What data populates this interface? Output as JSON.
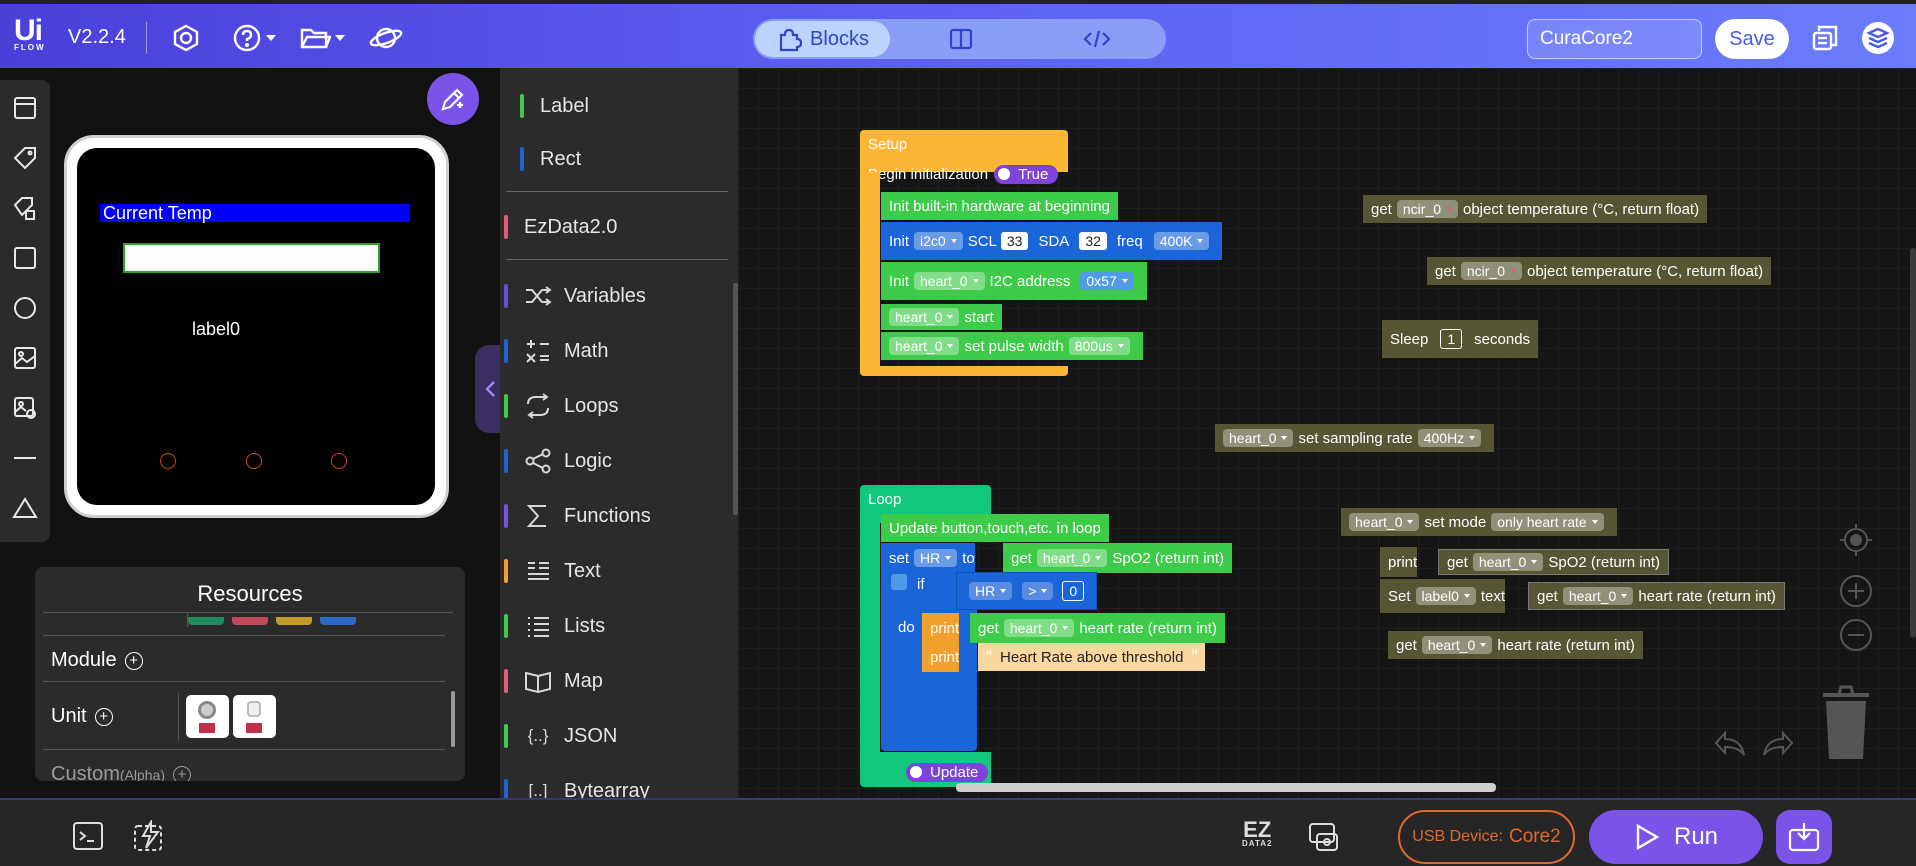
{
  "header": {
    "logo_top": "Ui",
    "logo_bottom": "FLOW",
    "version": "V2.2.4",
    "tabs": {
      "blocks": "Blocks"
    },
    "device_name": "CuraCore2",
    "save": "Save"
  },
  "preview": {
    "title_label": "Current Temp",
    "label0": "label0",
    "colors": {
      "title_bg": "#0000ff",
      "rect_border": "#2ea02e",
      "button_circle": "#d04a1a"
    }
  },
  "resources": {
    "title": "Resources",
    "module": "Module",
    "unit": "Unit",
    "custom": "Custom",
    "custom_tag": "(Alpha)"
  },
  "categories": [
    {
      "label": "Label",
      "color": "#3fcb4a"
    },
    {
      "label": "Rect",
      "color": "#1a66d9"
    },
    {
      "label": "EzData2.0",
      "color": "#e85a7a"
    },
    {
      "label": "Variables",
      "color": "#6b4cd8",
      "icon": "shuffle-icon"
    },
    {
      "label": "Math",
      "color": "#1a66d9",
      "icon": "math-icon"
    },
    {
      "label": "Loops",
      "color": "#3fcb4a",
      "icon": "loop-icon"
    },
    {
      "label": "Logic",
      "color": "#1a66d9",
      "icon": "logic-icon"
    },
    {
      "label": "Functions",
      "color": "#7a54e8",
      "icon": "sigma-icon"
    },
    {
      "label": "Text",
      "color": "#f1a02d",
      "icon": "text-icon"
    },
    {
      "label": "Lists",
      "color": "#3fcb4a",
      "icon": "list-icon"
    },
    {
      "label": "Map",
      "color": "#e85a7a",
      "icon": "map-icon"
    },
    {
      "label": "JSON",
      "color": "#3fcb4a",
      "icon": "json-icon",
      "glyph": "{..}"
    },
    {
      "label": "Bytearray",
      "color": "#1a66d9",
      "icon": "bytearray-icon",
      "glyph": "[..]"
    }
  ],
  "blocks": {
    "setup": "Setup",
    "begin_init": "Begin initialization",
    "true_val": "True",
    "init_builtin": "Init built-in hardware at beginning",
    "init": "Init",
    "i2c0": "i2c0",
    "scl": "SCL",
    "scl_val": "33",
    "sda": "SDA",
    "sda_val": "32",
    "freq": "freq",
    "freq_val": "400K",
    "heart_0": "heart_0",
    "i2c_address": "I2C address",
    "addr_val": "0x57",
    "start": "start",
    "set_pulse": "set pulse width",
    "pulse_val": "800us",
    "loop": "Loop",
    "update_loop": "Update button,touch,etc. in loop",
    "set": "set",
    "hr": "HR",
    "to": "to",
    "get": "get",
    "spo2": "SpO2 (return int)",
    "if": "if",
    "gt": ">",
    "zero": "0",
    "do": "do",
    "print": "print",
    "heart_rate": "heart rate (return int)",
    "threshold_text": "Heart Rate above threshold",
    "update": "Update",
    "ncir_0": "ncir_0",
    "obj_temp": "object temperature (°C, return float)",
    "sleep": "Sleep",
    "sleep_val": "1",
    "seconds": "seconds",
    "set_sampling": "set sampling rate",
    "sampling_val": "400Hz",
    "set_mode": "set mode",
    "mode_val": "only heart rate",
    "set_cap": "Set",
    "label0": "label0",
    "text": "text"
  },
  "footer": {
    "ez_top": "EZ",
    "ez_bottom": "DATA2",
    "usb_label": "USB Device:",
    "usb_device": "Core2",
    "run": "Run"
  }
}
